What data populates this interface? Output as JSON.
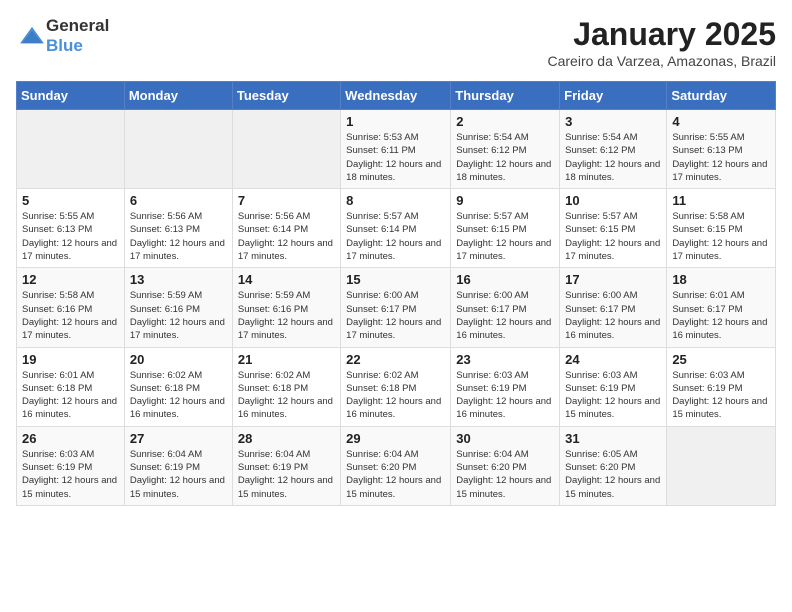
{
  "logo": {
    "general": "General",
    "blue": "Blue"
  },
  "header": {
    "month": "January 2025",
    "location": "Careiro da Varzea, Amazonas, Brazil"
  },
  "weekdays": [
    "Sunday",
    "Monday",
    "Tuesday",
    "Wednesday",
    "Thursday",
    "Friday",
    "Saturday"
  ],
  "weeks": [
    [
      {
        "day": "",
        "info": ""
      },
      {
        "day": "",
        "info": ""
      },
      {
        "day": "",
        "info": ""
      },
      {
        "day": "1",
        "info": "Sunrise: 5:53 AM\nSunset: 6:11 PM\nDaylight: 12 hours and 18 minutes."
      },
      {
        "day": "2",
        "info": "Sunrise: 5:54 AM\nSunset: 6:12 PM\nDaylight: 12 hours and 18 minutes."
      },
      {
        "day": "3",
        "info": "Sunrise: 5:54 AM\nSunset: 6:12 PM\nDaylight: 12 hours and 18 minutes."
      },
      {
        "day": "4",
        "info": "Sunrise: 5:55 AM\nSunset: 6:13 PM\nDaylight: 12 hours and 17 minutes."
      }
    ],
    [
      {
        "day": "5",
        "info": "Sunrise: 5:55 AM\nSunset: 6:13 PM\nDaylight: 12 hours and 17 minutes."
      },
      {
        "day": "6",
        "info": "Sunrise: 5:56 AM\nSunset: 6:13 PM\nDaylight: 12 hours and 17 minutes."
      },
      {
        "day": "7",
        "info": "Sunrise: 5:56 AM\nSunset: 6:14 PM\nDaylight: 12 hours and 17 minutes."
      },
      {
        "day": "8",
        "info": "Sunrise: 5:57 AM\nSunset: 6:14 PM\nDaylight: 12 hours and 17 minutes."
      },
      {
        "day": "9",
        "info": "Sunrise: 5:57 AM\nSunset: 6:15 PM\nDaylight: 12 hours and 17 minutes."
      },
      {
        "day": "10",
        "info": "Sunrise: 5:57 AM\nSunset: 6:15 PM\nDaylight: 12 hours and 17 minutes."
      },
      {
        "day": "11",
        "info": "Sunrise: 5:58 AM\nSunset: 6:15 PM\nDaylight: 12 hours and 17 minutes."
      }
    ],
    [
      {
        "day": "12",
        "info": "Sunrise: 5:58 AM\nSunset: 6:16 PM\nDaylight: 12 hours and 17 minutes."
      },
      {
        "day": "13",
        "info": "Sunrise: 5:59 AM\nSunset: 6:16 PM\nDaylight: 12 hours and 17 minutes."
      },
      {
        "day": "14",
        "info": "Sunrise: 5:59 AM\nSunset: 6:16 PM\nDaylight: 12 hours and 17 minutes."
      },
      {
        "day": "15",
        "info": "Sunrise: 6:00 AM\nSunset: 6:17 PM\nDaylight: 12 hours and 17 minutes."
      },
      {
        "day": "16",
        "info": "Sunrise: 6:00 AM\nSunset: 6:17 PM\nDaylight: 12 hours and 16 minutes."
      },
      {
        "day": "17",
        "info": "Sunrise: 6:00 AM\nSunset: 6:17 PM\nDaylight: 12 hours and 16 minutes."
      },
      {
        "day": "18",
        "info": "Sunrise: 6:01 AM\nSunset: 6:17 PM\nDaylight: 12 hours and 16 minutes."
      }
    ],
    [
      {
        "day": "19",
        "info": "Sunrise: 6:01 AM\nSunset: 6:18 PM\nDaylight: 12 hours and 16 minutes."
      },
      {
        "day": "20",
        "info": "Sunrise: 6:02 AM\nSunset: 6:18 PM\nDaylight: 12 hours and 16 minutes."
      },
      {
        "day": "21",
        "info": "Sunrise: 6:02 AM\nSunset: 6:18 PM\nDaylight: 12 hours and 16 minutes."
      },
      {
        "day": "22",
        "info": "Sunrise: 6:02 AM\nSunset: 6:18 PM\nDaylight: 12 hours and 16 minutes."
      },
      {
        "day": "23",
        "info": "Sunrise: 6:03 AM\nSunset: 6:19 PM\nDaylight: 12 hours and 16 minutes."
      },
      {
        "day": "24",
        "info": "Sunrise: 6:03 AM\nSunset: 6:19 PM\nDaylight: 12 hours and 15 minutes."
      },
      {
        "day": "25",
        "info": "Sunrise: 6:03 AM\nSunset: 6:19 PM\nDaylight: 12 hours and 15 minutes."
      }
    ],
    [
      {
        "day": "26",
        "info": "Sunrise: 6:03 AM\nSunset: 6:19 PM\nDaylight: 12 hours and 15 minutes."
      },
      {
        "day": "27",
        "info": "Sunrise: 6:04 AM\nSunset: 6:19 PM\nDaylight: 12 hours and 15 minutes."
      },
      {
        "day": "28",
        "info": "Sunrise: 6:04 AM\nSunset: 6:19 PM\nDaylight: 12 hours and 15 minutes."
      },
      {
        "day": "29",
        "info": "Sunrise: 6:04 AM\nSunset: 6:20 PM\nDaylight: 12 hours and 15 minutes."
      },
      {
        "day": "30",
        "info": "Sunrise: 6:04 AM\nSunset: 6:20 PM\nDaylight: 12 hours and 15 minutes."
      },
      {
        "day": "31",
        "info": "Sunrise: 6:05 AM\nSunset: 6:20 PM\nDaylight: 12 hours and 15 minutes."
      },
      {
        "day": "",
        "info": ""
      }
    ]
  ]
}
